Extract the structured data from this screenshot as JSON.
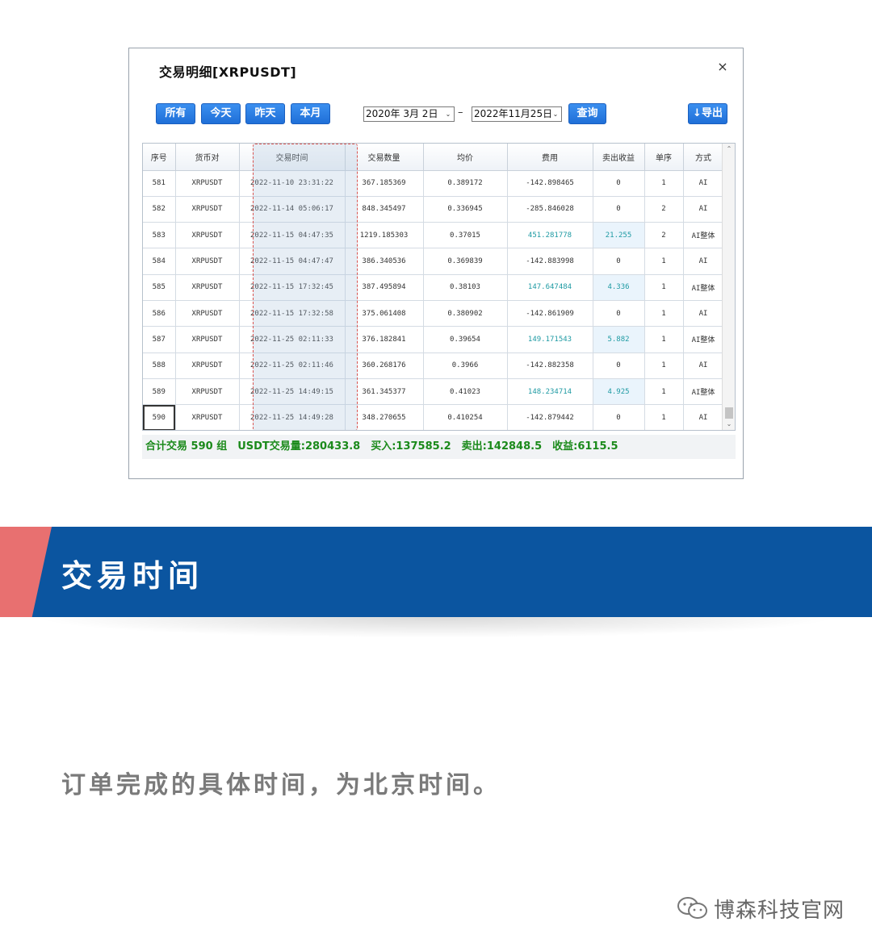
{
  "dialog": {
    "title": "交易明细[XRPUSDT]",
    "close_glyph": "×",
    "buttons": {
      "all": "所有",
      "today": "今天",
      "yesterday": "昨天",
      "this_month": "本月",
      "query": "查询",
      "export": "↓导出"
    },
    "date_from": "2020年 3月 2日",
    "date_to": "2022年11月25日",
    "date_separator": "–",
    "dropdown_glyph": "⌄"
  },
  "table": {
    "headers": [
      "序号",
      "货币对",
      "交易时间",
      "交易数量",
      "均价",
      "费用",
      "卖出收益",
      "单序",
      "方式"
    ],
    "rows": [
      [
        "581",
        "XRPUSDT",
        "2022-11-10 23:31:22",
        "367.185369",
        "0.389172",
        "-142.898465",
        "0",
        "1",
        "AI"
      ],
      [
        "582",
        "XRPUSDT",
        "2022-11-14 05:06:17",
        "848.345497",
        "0.336945",
        "-285.846028",
        "0",
        "2",
        "AI"
      ],
      [
        "583",
        "XRPUSDT",
        "2022-11-15 04:47:35",
        "1219.185303",
        "0.37015",
        "451.281778",
        "21.255",
        "2",
        "AI整体"
      ],
      [
        "584",
        "XRPUSDT",
        "2022-11-15 04:47:47",
        "386.340536",
        "0.369839",
        "-142.883998",
        "0",
        "1",
        "AI"
      ],
      [
        "585",
        "XRPUSDT",
        "2022-11-15 17:32:45",
        "387.495894",
        "0.38103",
        "147.647484",
        "4.336",
        "1",
        "AI整体"
      ],
      [
        "586",
        "XRPUSDT",
        "2022-11-15 17:32:58",
        "375.061408",
        "0.380902",
        "-142.861909",
        "0",
        "1",
        "AI"
      ],
      [
        "587",
        "XRPUSDT",
        "2022-11-25 02:11:33",
        "376.182841",
        "0.39654",
        "149.171543",
        "5.882",
        "1",
        "AI整体"
      ],
      [
        "588",
        "XRPUSDT",
        "2022-11-25 02:11:46",
        "360.268176",
        "0.3966",
        "-142.882358",
        "0",
        "1",
        "AI"
      ],
      [
        "589",
        "XRPUSDT",
        "2022-11-25 14:49:15",
        "361.345377",
        "0.41023",
        "148.234714",
        "4.925",
        "1",
        "AI整体"
      ],
      [
        "590",
        "XRPUSDT",
        "2022-11-25 14:49:28",
        "348.270655",
        "0.410254",
        "-142.879442",
        "0",
        "1",
        "AI"
      ]
    ],
    "scroll_up": "⌃",
    "scroll_down": "⌄"
  },
  "summary": "合计交易 590 组　USDT交易量:280433.8　买入:137585.2　卖出:142848.5　收益:6115.5",
  "banner": {
    "title": "交易时间"
  },
  "description": "订单完成的具体时间，为北京时间。",
  "footer": {
    "label": "博森科技官网",
    "icon": "wechat-icon"
  },
  "colors": {
    "banner_blue": "#0b55a0",
    "banner_red": "#e87070",
    "button_blue": "#2a7fe6",
    "summary_green": "#1b8a1b",
    "profit_teal": "#1e9aa3"
  }
}
